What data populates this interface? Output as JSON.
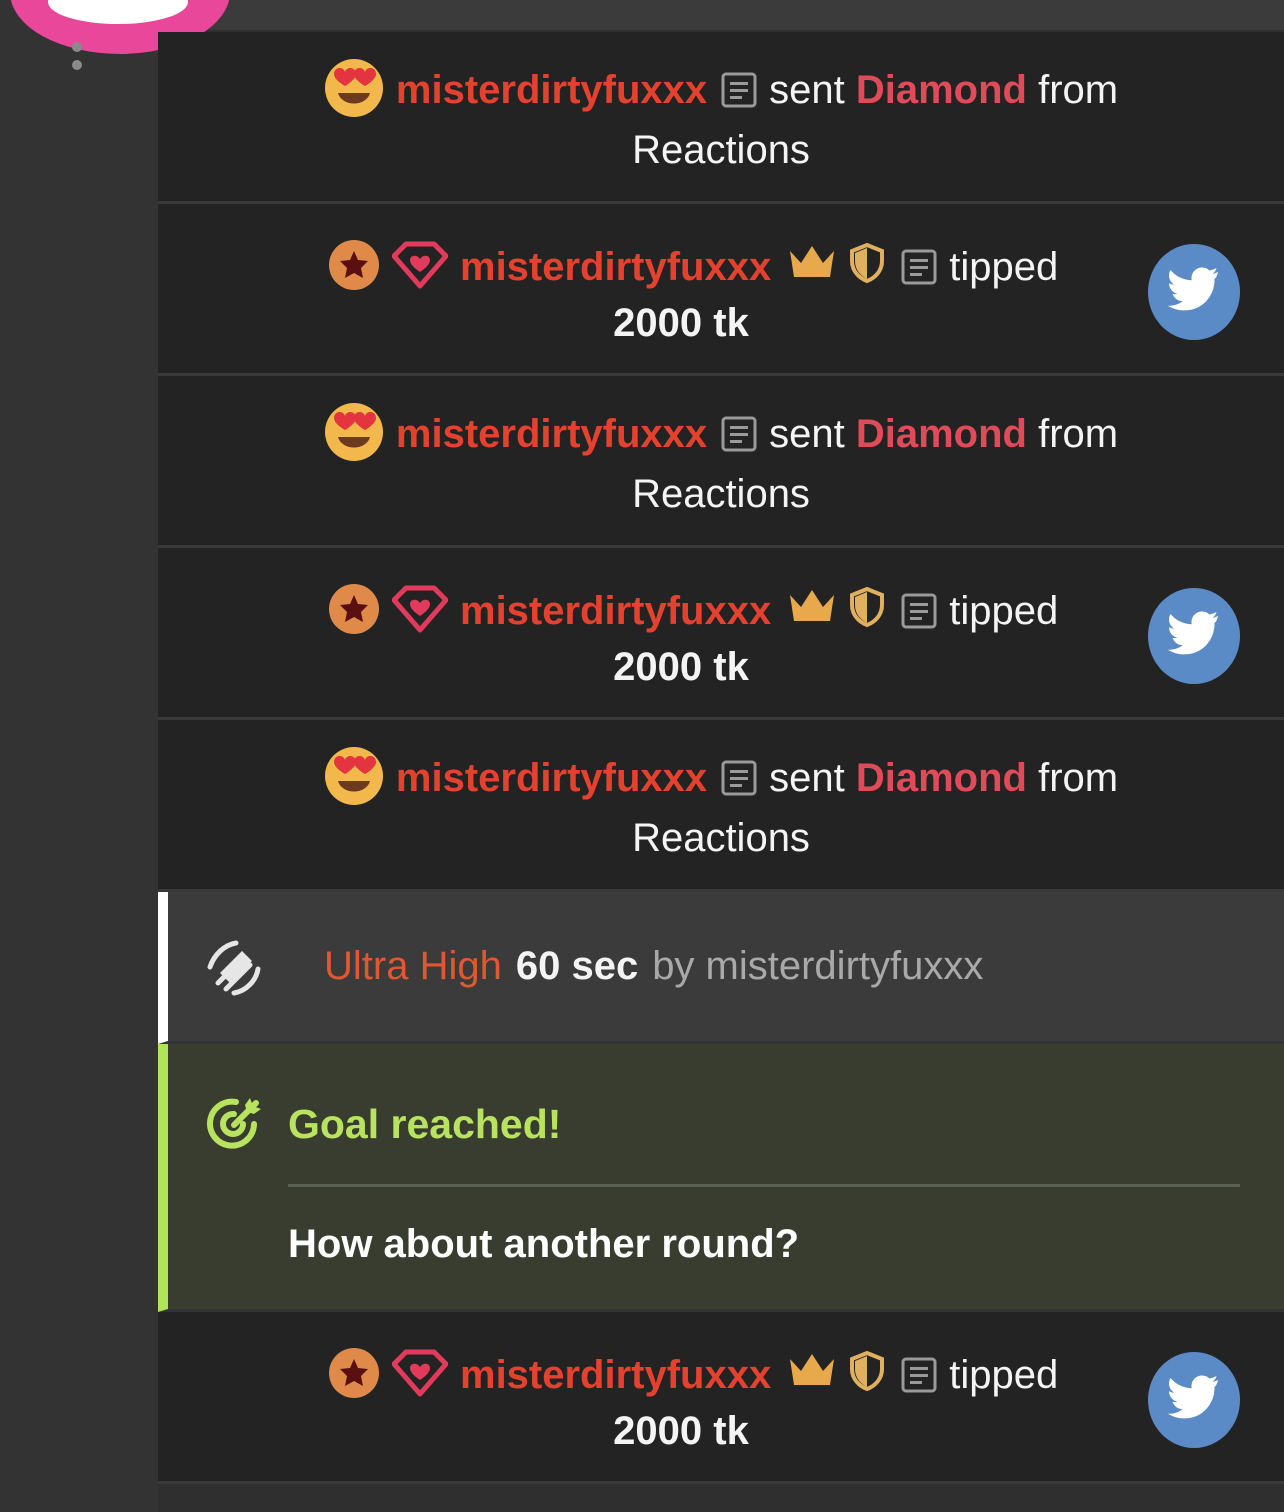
{
  "colors": {
    "username": "#e5412f",
    "diamond": "#e04b59",
    "goal_accent": "#b0e45a",
    "lush_level": "#e0582f",
    "twitter": "#5b8bc7",
    "avatar": "#e8479a"
  },
  "feed": {
    "messages": [
      {
        "kind": "reaction",
        "icon": "heart-eyes-emoji-icon",
        "username": "misterdirtyfuxxx",
        "verb": "sent",
        "gift": "Diamond",
        "from": "from",
        "source": "Reactions"
      },
      {
        "kind": "tip",
        "icons": [
          "star-badge-icon",
          "diamond-heart-icon",
          "crown-icon",
          "shield-icon",
          "notes-icon"
        ],
        "username": "misterdirtyfuxxx",
        "verb": "tipped",
        "amount": "2000 tk",
        "share_icon": "twitter-icon"
      },
      {
        "kind": "reaction",
        "icon": "heart-eyes-emoji-icon",
        "username": "misterdirtyfuxxx",
        "verb": "sent",
        "gift": "Diamond",
        "from": "from",
        "source": "Reactions"
      },
      {
        "kind": "tip",
        "icons": [
          "star-badge-icon",
          "diamond-heart-icon",
          "crown-icon",
          "shield-icon",
          "notes-icon"
        ],
        "username": "misterdirtyfuxxx",
        "verb": "tipped",
        "amount": "2000 tk",
        "share_icon": "twitter-icon"
      },
      {
        "kind": "reaction",
        "icon": "heart-eyes-emoji-icon",
        "username": "misterdirtyfuxxx",
        "verb": "sent",
        "gift": "Diamond",
        "from": "from",
        "source": "Reactions"
      },
      {
        "kind": "vibration",
        "icon": "vibration-icon",
        "level": "Ultra High",
        "duration": "60 sec",
        "by": "by misterdirtyfuxxx"
      },
      {
        "kind": "goal",
        "icon": "target-icon",
        "title": "Goal reached!",
        "subtitle": "How about another round?"
      },
      {
        "kind": "tip",
        "icons": [
          "star-badge-icon",
          "diamond-heart-icon",
          "crown-icon",
          "shield-icon",
          "notes-icon"
        ],
        "username": "misterdirtyfuxxx",
        "verb": "tipped",
        "amount": "2000 tk",
        "share_icon": "twitter-icon"
      }
    ]
  }
}
